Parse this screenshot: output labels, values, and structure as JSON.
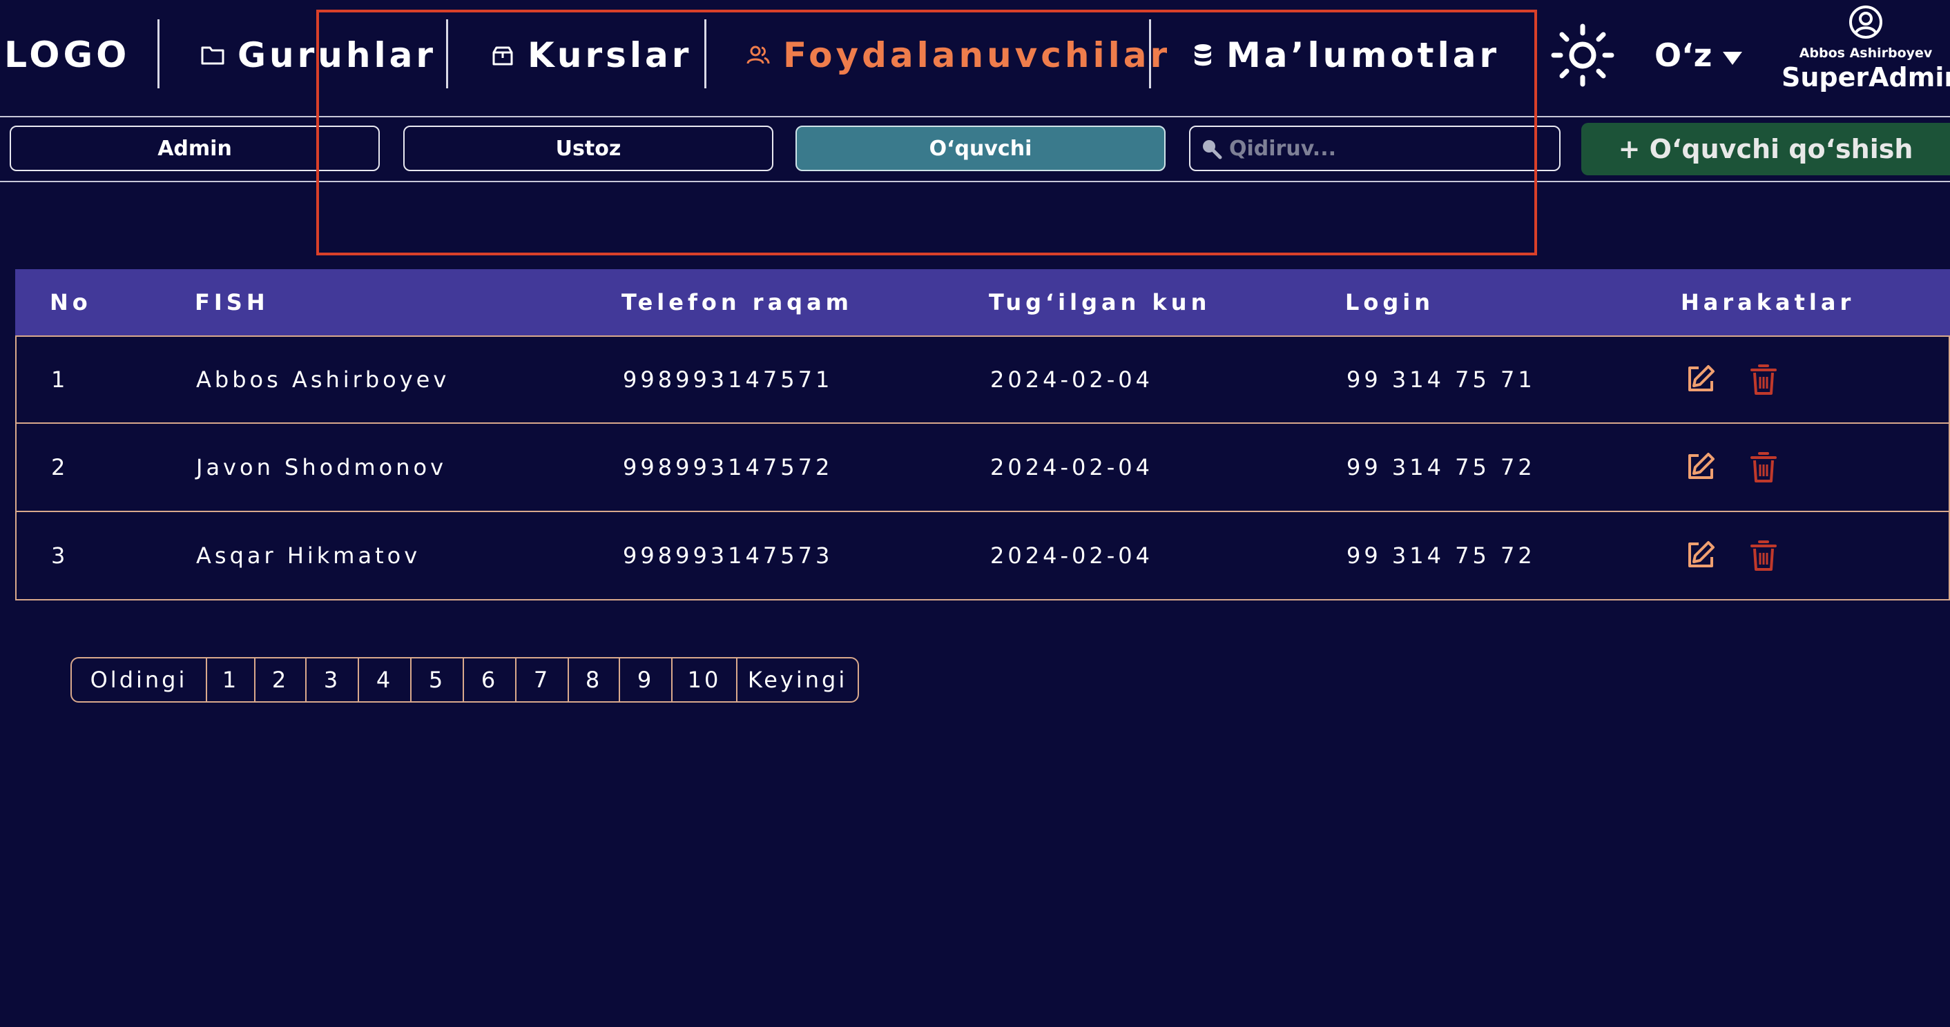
{
  "header": {
    "logo": "LOGO",
    "nav": [
      {
        "label": "Guruhlar",
        "icon": "folder-icon",
        "active": false
      },
      {
        "label": "Kurslar",
        "icon": "box-icon",
        "active": false
      },
      {
        "label": "Foydalanuvchilar",
        "icon": "users-icon",
        "active": true
      },
      {
        "label": "Ma’lumotlar",
        "icon": "database-icon",
        "active": false
      }
    ],
    "theme_icon": "sun-icon",
    "language": "O‘z",
    "user": {
      "name": "Abbos Ashirboyev",
      "role": "SuperAdmin",
      "icon": "user-circle-icon"
    }
  },
  "filters": {
    "roles": [
      "Admin",
      "Ustoz",
      "O‘quvchi"
    ],
    "active_role": "O‘quvchi",
    "search": {
      "placeholder": "Qidiruv...",
      "value": ""
    },
    "add_button": "+ O‘quvchi qo‘shish"
  },
  "table": {
    "columns": [
      "No",
      "FISH",
      "Telefon raqam",
      "Tug‘ilgan kun",
      "Login",
      "Harakatlar"
    ],
    "rows": [
      {
        "no": "1",
        "fish": "Abbos Ashirboyev",
        "phone": "998993147571",
        "birthday": "2024-02-04",
        "login": "99 314 75 71"
      },
      {
        "no": "2",
        "fish": "Javon Shodmonov",
        "phone": "998993147572",
        "birthday": "2024-02-04",
        "login": "99 314 75 72"
      },
      {
        "no": "3",
        "fish": "Asqar Hikmatov",
        "phone": "998993147573",
        "birthday": "2024-02-04",
        "login": "99 314 75 72"
      }
    ]
  },
  "pagination": {
    "prev": "Oldingi",
    "pages": [
      "1",
      "2",
      "3",
      "4",
      "5",
      "6",
      "7",
      "8",
      "9",
      "10"
    ],
    "next": "Keyingi"
  },
  "colors": {
    "background": "#0a0a38",
    "accent_orange": "#ef7d4c",
    "table_header": "#423999",
    "active_filter": "#3a7a8c",
    "add_button": "#1c5338",
    "edit_icon": "#f0a070",
    "delete_icon": "#c0392b",
    "highlight": "#d9402a"
  }
}
